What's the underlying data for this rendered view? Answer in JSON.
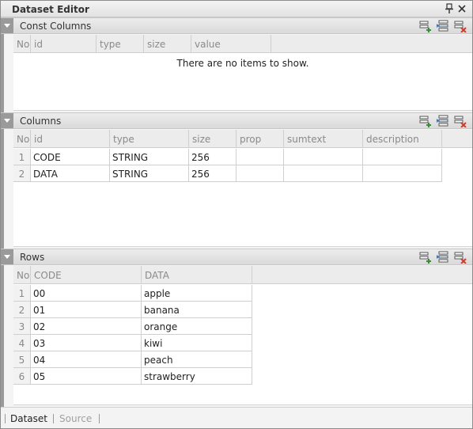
{
  "window": {
    "title": "Dataset Editor"
  },
  "const_columns": {
    "label": "Const Columns",
    "headers": [
      "No",
      "id",
      "type",
      "size",
      "value"
    ],
    "empty_message": "There are no items to show."
  },
  "columns": {
    "label": "Columns",
    "headers": [
      "No",
      "id",
      "type",
      "size",
      "prop",
      "sumtext",
      "description"
    ],
    "rows": [
      {
        "no": "1",
        "id": "CODE",
        "type": "STRING",
        "size": "256",
        "prop": "",
        "sumtext": "",
        "description": ""
      },
      {
        "no": "2",
        "id": "DATA",
        "type": "STRING",
        "size": "256",
        "prop": "",
        "sumtext": "",
        "description": ""
      }
    ]
  },
  "rows": {
    "label": "Rows",
    "headers": [
      "No",
      "CODE",
      "DATA"
    ],
    "rows": [
      {
        "no": "1",
        "code": "00",
        "data": "apple"
      },
      {
        "no": "2",
        "code": "01",
        "data": "banana"
      },
      {
        "no": "3",
        "code": "02",
        "data": "orange"
      },
      {
        "no": "4",
        "code": "03",
        "data": "kiwi"
      },
      {
        "no": "5",
        "code": "04",
        "data": "peach"
      },
      {
        "no": "6",
        "code": "05",
        "data": "strawberry"
      }
    ]
  },
  "tabs": {
    "dataset": "Dataset",
    "source": "Source"
  },
  "icons": {
    "pin": "pin-icon",
    "close": "close-icon",
    "add_row": "add-row-icon",
    "insert_row": "insert-row-icon",
    "delete_row": "delete-row-icon",
    "collapse": "collapse-arrow-icon"
  },
  "colors": {
    "delete_accent": "#d23a2a",
    "add_accent": "#3a8a3a",
    "strip": "#9a9a9a"
  }
}
